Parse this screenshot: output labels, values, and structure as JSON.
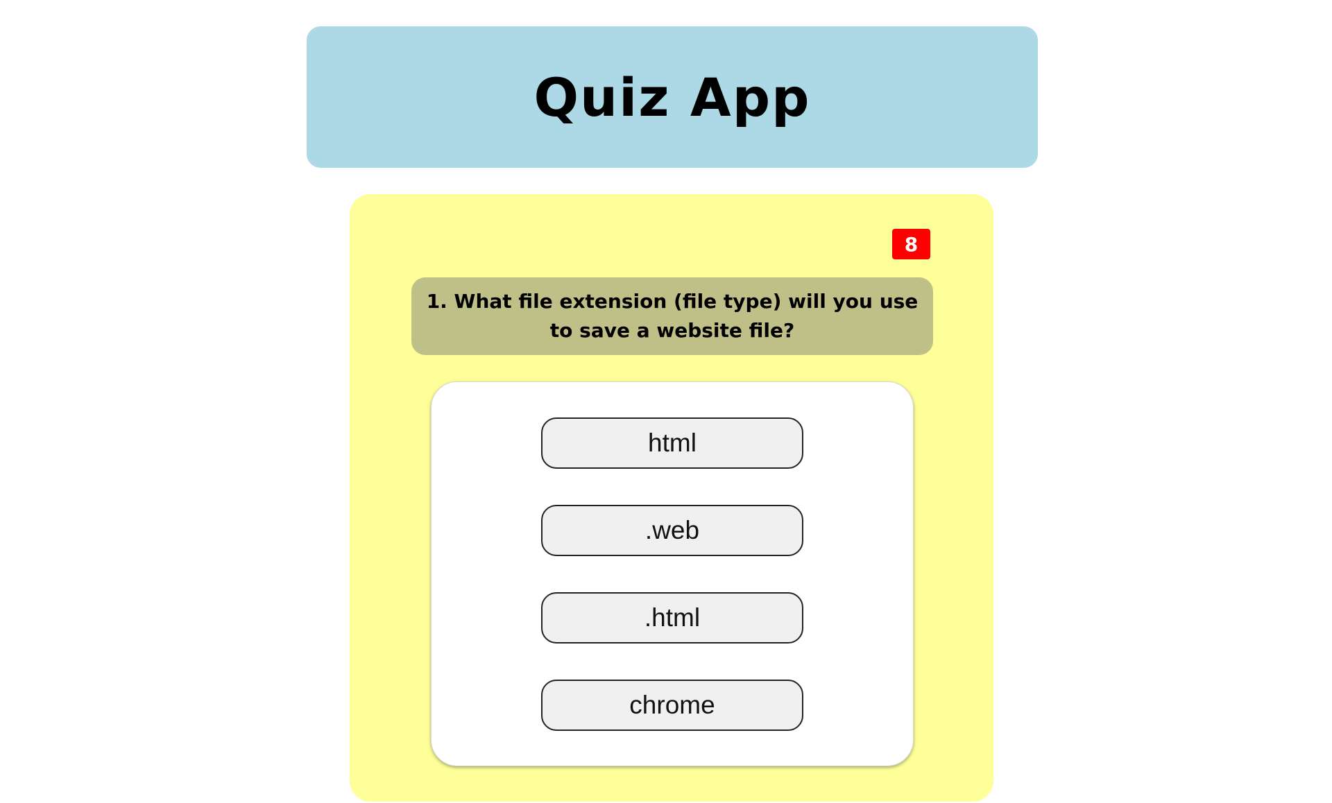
{
  "header": {
    "title": "Quiz App"
  },
  "quiz": {
    "timer": "8",
    "question": "1. What file extension (file type) will you use to save a website file?",
    "options": [
      "html",
      ".web",
      ".html",
      "chrome"
    ]
  },
  "colors": {
    "header_bg": "#add8e6",
    "card_bg": "#ffff99",
    "question_bg": "#bfbf88",
    "timer_bg": "#ff0000",
    "option_bg": "#f0f0f0"
  }
}
